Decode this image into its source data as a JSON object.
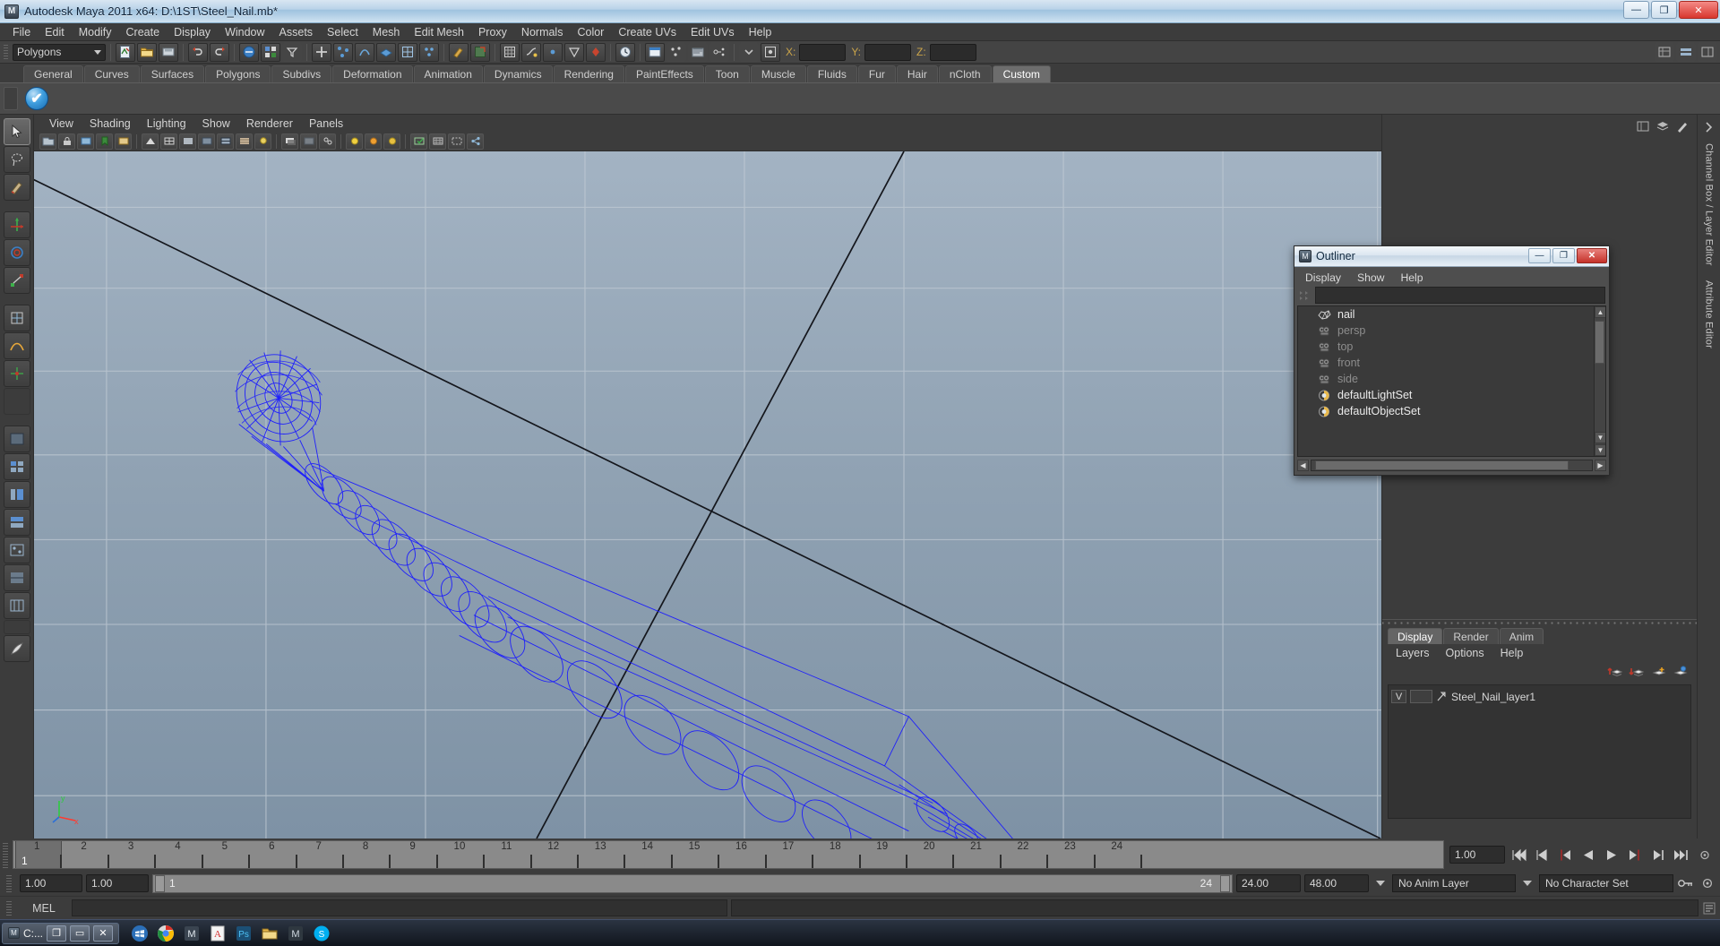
{
  "window": {
    "title": "Autodesk Maya 2011 x64: D:\\1ST\\Steel_Nail.mb*",
    "app_icon": "maya-icon",
    "minimize": "—",
    "maximize": "❐",
    "close": "✕"
  },
  "menubar": {
    "items": [
      "File",
      "Edit",
      "Modify",
      "Create",
      "Display",
      "Window",
      "Assets",
      "Select",
      "Mesh",
      "Edit Mesh",
      "Proxy",
      "Normals",
      "Color",
      "Create UVs",
      "Edit UVs",
      "Help"
    ]
  },
  "statusline": {
    "menuset": "Polygons",
    "coord_labels": [
      "X:",
      "Y:",
      "Z:"
    ],
    "coord_values": [
      "",
      "",
      ""
    ]
  },
  "shelf": {
    "tabs": [
      "General",
      "Curves",
      "Surfaces",
      "Polygons",
      "Subdivs",
      "Deformation",
      "Animation",
      "Dynamics",
      "Rendering",
      "PaintEffects",
      "Toon",
      "Muscle",
      "Fluids",
      "Fur",
      "Hair",
      "nCloth",
      "Custom"
    ],
    "active_tab": "Custom",
    "item_icon": "blue-checkmark-icon"
  },
  "viewport": {
    "panel_menus": [
      "View",
      "Shading",
      "Lighting",
      "Show",
      "Renderer",
      "Panels"
    ],
    "origin_label": "",
    "axis_x": "x",
    "axis_y": "y",
    "object_color": "#1a1aff",
    "grid_color": "#c8d2dc",
    "bg_top": "#9fb0c0",
    "bg_bottom": "#7f93a6"
  },
  "outliner": {
    "title": "Outliner",
    "menus": [
      "Display",
      "Show",
      "Help"
    ],
    "minimize": "—",
    "maximize": "❐",
    "close": "✕",
    "items": [
      {
        "label": "nail",
        "icon": "mesh-icon",
        "dimmed": false
      },
      {
        "label": "persp",
        "icon": "camera-icon",
        "dimmed": true
      },
      {
        "label": "top",
        "icon": "camera-icon",
        "dimmed": true
      },
      {
        "label": "front",
        "icon": "camera-icon",
        "dimmed": true
      },
      {
        "label": "side",
        "icon": "camera-icon",
        "dimmed": true
      },
      {
        "label": "defaultLightSet",
        "icon": "set-icon",
        "dimmed": false
      },
      {
        "label": "defaultObjectSet",
        "icon": "set-icon",
        "dimmed": false
      }
    ]
  },
  "right_dock": {
    "labels": [
      "Channel Box / Layer Editor",
      "Attribute Editor"
    ]
  },
  "layer_editor": {
    "tabs": [
      "Display",
      "Render",
      "Anim"
    ],
    "active_tab": "Display",
    "menus": [
      "Layers",
      "Options",
      "Help"
    ],
    "layers": [
      {
        "visibility": "V",
        "type": "",
        "name": "Steel_Nail_layer1"
      }
    ]
  },
  "timeline": {
    "ticks": [
      "1",
      "2",
      "3",
      "4",
      "5",
      "6",
      "7",
      "8",
      "9",
      "10",
      "11",
      "12",
      "13",
      "14",
      "15",
      "16",
      "17",
      "18",
      "19",
      "20",
      "21",
      "22",
      "23",
      "24"
    ],
    "current_frame": "1",
    "current_frame_field": "1.00"
  },
  "range": {
    "start": "1.00",
    "end": "1.00",
    "slider_start": "1",
    "slider_end": "24",
    "playback_end": "24.00",
    "anim_end": "48.00",
    "anim_layer": "No Anim Layer",
    "character_set": "No Character Set"
  },
  "command_line": {
    "label": "MEL",
    "input": "",
    "output": ""
  },
  "taskbar": {
    "window_label": "C:...",
    "restore": "❐",
    "maximize": "▭",
    "close": "✕"
  }
}
